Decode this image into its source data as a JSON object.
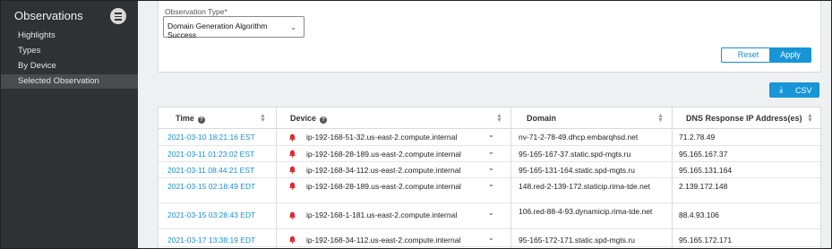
{
  "sidebar": {
    "title": "Observations",
    "menu_icon": "hamburger-icon",
    "items": [
      {
        "label": "Highlights"
      },
      {
        "label": "Types"
      },
      {
        "label": "By Device"
      },
      {
        "label": "Selected Observation",
        "active": true
      }
    ]
  },
  "filter": {
    "observation_type_label": "Observation Type*",
    "observation_type_value": "Domain Generation Algorithm Success",
    "reset_label": "Reset",
    "apply_label": "Apply"
  },
  "export": {
    "csv_label": "CSV",
    "icon": "download-icon"
  },
  "table": {
    "columns": [
      {
        "label": "Time",
        "help": "?"
      },
      {
        "label": "Device",
        "help": "?"
      },
      {
        "label": "Domain"
      },
      {
        "label": "DNS Response IP Address(es)"
      }
    ],
    "rows": [
      {
        "time": "2021-03-10 18:21:16 EST",
        "device": "ip-192-168-51-32.us-east-2.compute.internal",
        "domain": "nv-71-2-78-49.dhcp.embarqhsd.net",
        "ip": "71.2.78.49"
      },
      {
        "time": "2021-03-11 01:23:02 EST",
        "device": "ip-192-168-28-189.us-east-2.compute.internal",
        "domain": "95-165-167-37.static.spd-mgts.ru",
        "ip": "95.165.167.37"
      },
      {
        "time": "2021-03-11 08:44:21 EST",
        "device": "ip-192-168-34-112.us-east-2.compute.internal",
        "domain": "95-165-131-164.static.spd-mgts.ru",
        "ip": "95.165.131.164"
      },
      {
        "time": "2021-03-15 02:18:49 EDT",
        "device": "ip-192-168-28-189.us-east-2.compute.internal",
        "domain": "148.red-2-139-172.staticip.rima-tde.net",
        "ip": "2.139.172.148"
      },
      {
        "time": "2021-03-15 03:28:43 EDT",
        "device": "ip-192-168-1-181.us-east-2.compute.internal",
        "domain": "106.red-88-4-93.dynamicip.rima-tde.net",
        "ip": "88.4.93.106"
      },
      {
        "time": "2021-03-17 13:38:19 EDT",
        "device": "ip-192-168-34-112.us-east-2.compute.internal",
        "domain": "95-165-172-171.static.spd-mgts.ru",
        "ip": "95.165.172.171"
      }
    ]
  },
  "colors": {
    "accent": "#1795d6",
    "alert": "#e0282e",
    "sidebar_bg": "#303133"
  }
}
